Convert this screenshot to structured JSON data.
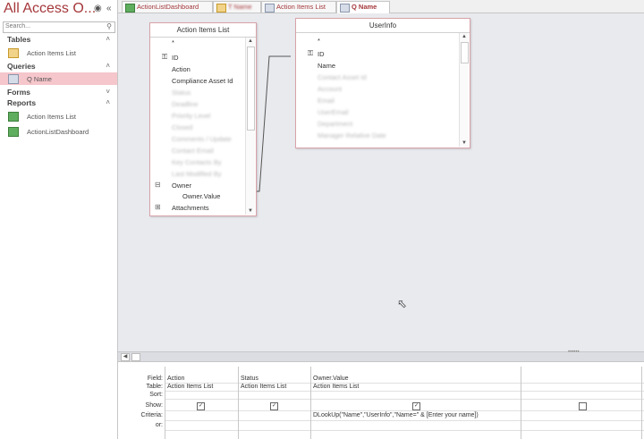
{
  "nav": {
    "title": "All Access O...",
    "search_placeholder": "Search...",
    "sections": [
      {
        "label": "Tables",
        "chev": "˄"
      },
      {
        "label": "Queries",
        "chev": "˄"
      },
      {
        "label": "Forms",
        "chev": "˅"
      },
      {
        "label": "Reports",
        "chev": "˄"
      }
    ],
    "tables": [
      "Action Items List"
    ],
    "queries": [
      "Q Name"
    ],
    "reports": [
      "Action Items List",
      "ActionListDashboard"
    ]
  },
  "tabs": [
    {
      "label": "ActionListDashboard"
    },
    {
      "label": "T Name"
    },
    {
      "label": "Action Items List"
    },
    {
      "label": "Q Name"
    }
  ],
  "tables": {
    "action_items": {
      "title": "Action Items List",
      "fields": [
        "*",
        "ID",
        "Action",
        "Compliance Asset Id",
        "Status",
        "Deadline",
        "Priority Level",
        "Closed",
        "Comments / Update",
        "Contact Email",
        "Key Contacts By",
        "Last Modified By",
        "Owner",
        "Owner.Value",
        "Attachments"
      ]
    },
    "userinfo": {
      "title": "UserInfo",
      "fields": [
        "*",
        "ID",
        "Name",
        "Contact Asset Id",
        "Account",
        "Email",
        "UserEmail",
        "Department",
        "Manager Relative Date"
      ]
    }
  },
  "grid": {
    "row_headers": [
      "Field:",
      "Table:",
      "Sort:",
      "Show:",
      "Criteria:",
      "or:"
    ],
    "columns": [
      {
        "field": "Action",
        "table": "Action Items List",
        "criteria": "",
        "show": true
      },
      {
        "field": "Status",
        "table": "Action Items List",
        "criteria": "",
        "show": true
      },
      {
        "field": "Owner.Value",
        "table": "Action Items List",
        "criteria": "DLookUp(\"Name\",\"UserInfo\",\"Name=\" & [Enter your name])",
        "show": true
      },
      {
        "field": "",
        "table": "",
        "criteria": "",
        "show": false
      }
    ]
  }
}
